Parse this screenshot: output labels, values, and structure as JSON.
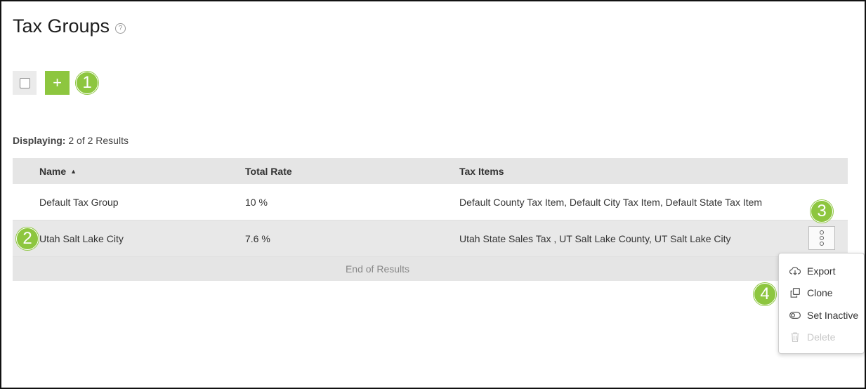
{
  "page": {
    "title": "Tax Groups",
    "help_icon": "question-circle-icon"
  },
  "toolbar": {
    "add_label": "+",
    "select_all_icon": "checkbox-icon"
  },
  "badges": {
    "b1": "1",
    "b2": "2",
    "b3": "3",
    "b4": "4"
  },
  "colors": {
    "accent": "#8dc63f",
    "header_bg": "#e5e5e5"
  },
  "results": {
    "label": "Displaying:",
    "text": "2 of 2 Results"
  },
  "table": {
    "headers": {
      "name": "Name",
      "total_rate": "Total Rate",
      "tax_items": "Tax Items"
    },
    "sort_icon": "caret-up-icon",
    "rows": [
      {
        "name": "Default Tax Group",
        "rate": "10 %",
        "items": "Default County Tax Item, Default City Tax Item, Default State Tax Item"
      },
      {
        "name": "Utah Salt Lake City",
        "rate": "7.6 %",
        "items": "Utah State Sales Tax , UT Salt Lake County, UT Salt Lake City"
      }
    ],
    "end_text": "End of Results"
  },
  "menu": {
    "items": [
      {
        "label": "Export",
        "icon": "cloud-download-icon",
        "disabled": false
      },
      {
        "label": "Clone",
        "icon": "clone-icon",
        "disabled": false
      },
      {
        "label": "Set Inactive",
        "icon": "toggle-off-icon",
        "disabled": false
      },
      {
        "label": "Delete",
        "icon": "trash-icon",
        "disabled": true
      }
    ]
  }
}
